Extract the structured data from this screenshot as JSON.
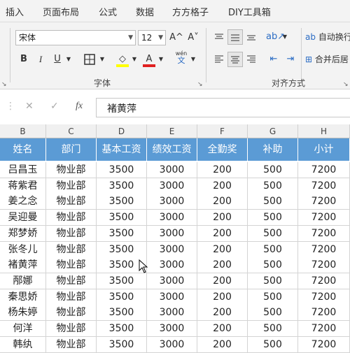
{
  "menu": {
    "tabs": [
      "插入",
      "页面布局",
      "公式",
      "数据",
      "方方格子",
      "DIY工具箱"
    ]
  },
  "ribbon": {
    "font_name": "宋体",
    "font_size": "12",
    "grow_label": "A^",
    "shrink_label": "A˅",
    "bold": "B",
    "italic": "I",
    "underline": "U",
    "font_color_letter": "A",
    "phonetic_top": "wén",
    "phonetic_bottom": "文",
    "font_group": "字体",
    "align_group": "对齐方式",
    "wrap_text": "自动换行",
    "merge_center": "合并后居",
    "fill_color": "#ffff00",
    "font_color": "#e02020"
  },
  "formula_bar": {
    "cancel": "✕",
    "enter": "✓",
    "fx": "fx",
    "value": "褚黄萍"
  },
  "sheet": {
    "col_letters": [
      "B",
      "C",
      "D",
      "E",
      "F",
      "G",
      "H"
    ],
    "headers": [
      "姓名",
      "部门",
      "基本工资",
      "绩效工资",
      "全勤奖",
      "补助",
      "小计"
    ],
    "header_color": "#5b9bd5",
    "rows": [
      [
        "吕昌玉",
        "物业部",
        "3500",
        "3000",
        "200",
        "500",
        "7200"
      ],
      [
        "蒋紫君",
        "物业部",
        "3500",
        "3000",
        "200",
        "500",
        "7200"
      ],
      [
        "姜之念",
        "物业部",
        "3500",
        "3000",
        "200",
        "500",
        "7200"
      ],
      [
        "吴迎曼",
        "物业部",
        "3500",
        "3000",
        "200",
        "500",
        "7200"
      ],
      [
        "郑梦娇",
        "物业部",
        "3500",
        "3000",
        "200",
        "500",
        "7200"
      ],
      [
        "张冬儿",
        "物业部",
        "3500",
        "3000",
        "200",
        "500",
        "7200"
      ],
      [
        "褚黄萍",
        "物业部",
        "3500",
        "3000",
        "200",
        "500",
        "7200"
      ],
      [
        "邴娜",
        "物业部",
        "3500",
        "3000",
        "200",
        "500",
        "7200"
      ],
      [
        "秦思娇",
        "物业部",
        "3500",
        "3000",
        "200",
        "500",
        "7200"
      ],
      [
        "杨朱婷",
        "物业部",
        "3500",
        "3000",
        "200",
        "500",
        "7200"
      ],
      [
        "何洋",
        "物业部",
        "3500",
        "3000",
        "200",
        "500",
        "7200"
      ],
      [
        "韩纨",
        "物业部",
        "3500",
        "3000",
        "200",
        "500",
        "7200"
      ]
    ]
  }
}
